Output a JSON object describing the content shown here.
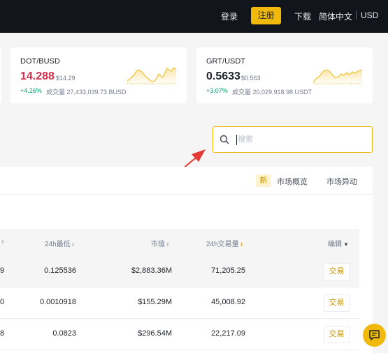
{
  "header": {
    "login": "登录",
    "register": "注册",
    "download": "下载",
    "language": "简体中文",
    "currency": "USD"
  },
  "tickers": [
    {
      "pair": "DOT/BUSD",
      "price": "14.288",
      "usd_price": "$14.29",
      "change": "+4.26%",
      "volume": "成交量 27,433,039.73 BUSD",
      "price_color": "#cf304a"
    },
    {
      "pair": "GRT/USDT",
      "price": "0.5633",
      "usd_price": "$0.563",
      "change": "+3.07%",
      "volume": "成交量 20,029,918.98 USDT",
      "price_color": "#1e2329"
    }
  ],
  "search": {
    "placeholder": "搜索",
    "icon": "search-icon"
  },
  "tabs": {
    "new_badge": "新",
    "overview": "市场概览",
    "movers": "市场异动"
  },
  "table": {
    "columns": [
      {
        "label": "24h最低"
      },
      {
        "label": "市值"
      },
      {
        "label": "24h交易量"
      },
      {
        "label": "编辑"
      }
    ],
    "rows": [
      {
        "cut_prefix": "9",
        "low": "0.125536",
        "market_cap": "$2,883.36M",
        "volume": "71,205.25",
        "action": "交易"
      },
      {
        "cut_prefix": "0",
        "low": "0.0010918",
        "market_cap": "$155.29M",
        "volume": "45,008.92",
        "action": "交易"
      },
      {
        "cut_prefix": "8",
        "low": "0.0823",
        "market_cap": "$296.54M",
        "volume": "22,217.09",
        "action": "交易"
      }
    ]
  },
  "colors": {
    "accent": "#f0b90b",
    "up": "#03a66d",
    "down": "#cf304a",
    "annotation": "#e53935"
  }
}
